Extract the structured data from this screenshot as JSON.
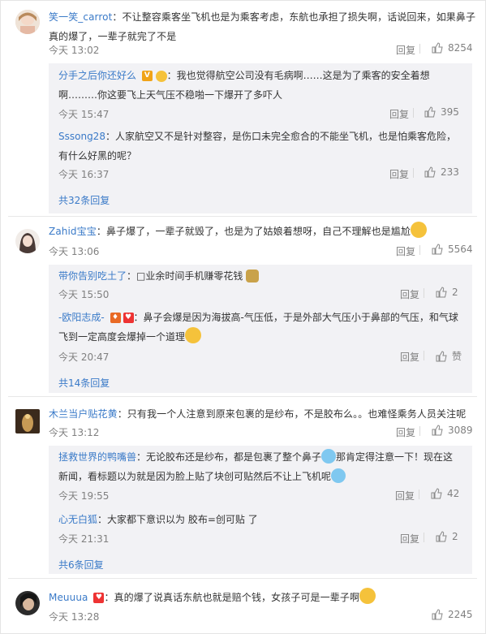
{
  "ui": {
    "reply_label": "回复",
    "like_color": "#808080",
    "link_color": "#3a7ac8"
  },
  "comments": [
    {
      "user": "笑一笑_carrot",
      "text_l1": "：不让整容乘客坐飞机也是为乘客考虑，东航也承担了损失啊，话说回来，如果鼻子",
      "text_l2": "真的爆了，一辈子就完了不是",
      "time": "今天 13:02",
      "likes": "8254",
      "replies": [
        {
          "user": "分手之后你还好么",
          "text_l1": "：我也觉得航空公司没有毛病啊……这是为了乘客的安全着想",
          "text_l2": "啊………你这要飞上天气压不稳啪一下爆开了多吓人",
          "time": "今天 15:47",
          "likes": "395"
        },
        {
          "user": "Sssong28",
          "text_l1": "：人家航空又不是针对整容，是伤口未完全愈合的不能坐飞机，也是怕乘客危险，",
          "text_l2": "有什么好黑的呢？",
          "time": "今天 16:37",
          "likes": "233"
        }
      ],
      "more": "共32条回复"
    },
    {
      "user": "Zahid宝宝",
      "text_l1": "：鼻子爆了，一辈子就毁了，也是为了姑娘着想呀，自己不理解也是尴尬",
      "time": "今天 13:06",
      "likes": "5564",
      "replies": [
        {
          "user": "带你告别吃土了",
          "text_l1": "：□业余时间手机赚零花钱",
          "time": "今天 15:50",
          "likes": "2"
        },
        {
          "user": "-欧阳志成-",
          "text_l1": "：鼻子会爆是因为海拔高-气压低，于是外部大气压小于鼻部的气压，和气球",
          "text_l2": "飞到一定高度会爆掉一个道理",
          "time": "今天 20:47",
          "likes": "赞"
        }
      ],
      "more": "共14条回复"
    },
    {
      "user": "木兰当户贴花黄",
      "text_l1": "：只有我一个人注意到原来包裹的是纱布，不是胶布么。。也难怪乘务人员关注呢",
      "time": "今天 13:12",
      "likes": "3089",
      "replies": [
        {
          "user": "拯救世界的鸭嘴兽",
          "text_l1": "：无论胶布还是纱布，都是包裹了整个鼻子",
          "text_l1b": "那肯定得注意一下！现在这",
          "text_l2": "新闻，看标题以为就是因为脸上贴了块创可贴然后不让上飞机呢",
          "time": "今天 19:55",
          "likes": "42"
        },
        {
          "user": "心无白狐",
          "text_l1": "：大家都下意识以为 胶布=创可贴 了",
          "time": "今天 21:31",
          "likes": "2"
        }
      ],
      "more": "共6条回复"
    },
    {
      "user": "Meuuua",
      "text_l1": "：真的爆了说真话东航也就是赔个钱，女孩子可是一辈子啊",
      "time": "今天 13:28",
      "likes": "2245"
    }
  ]
}
